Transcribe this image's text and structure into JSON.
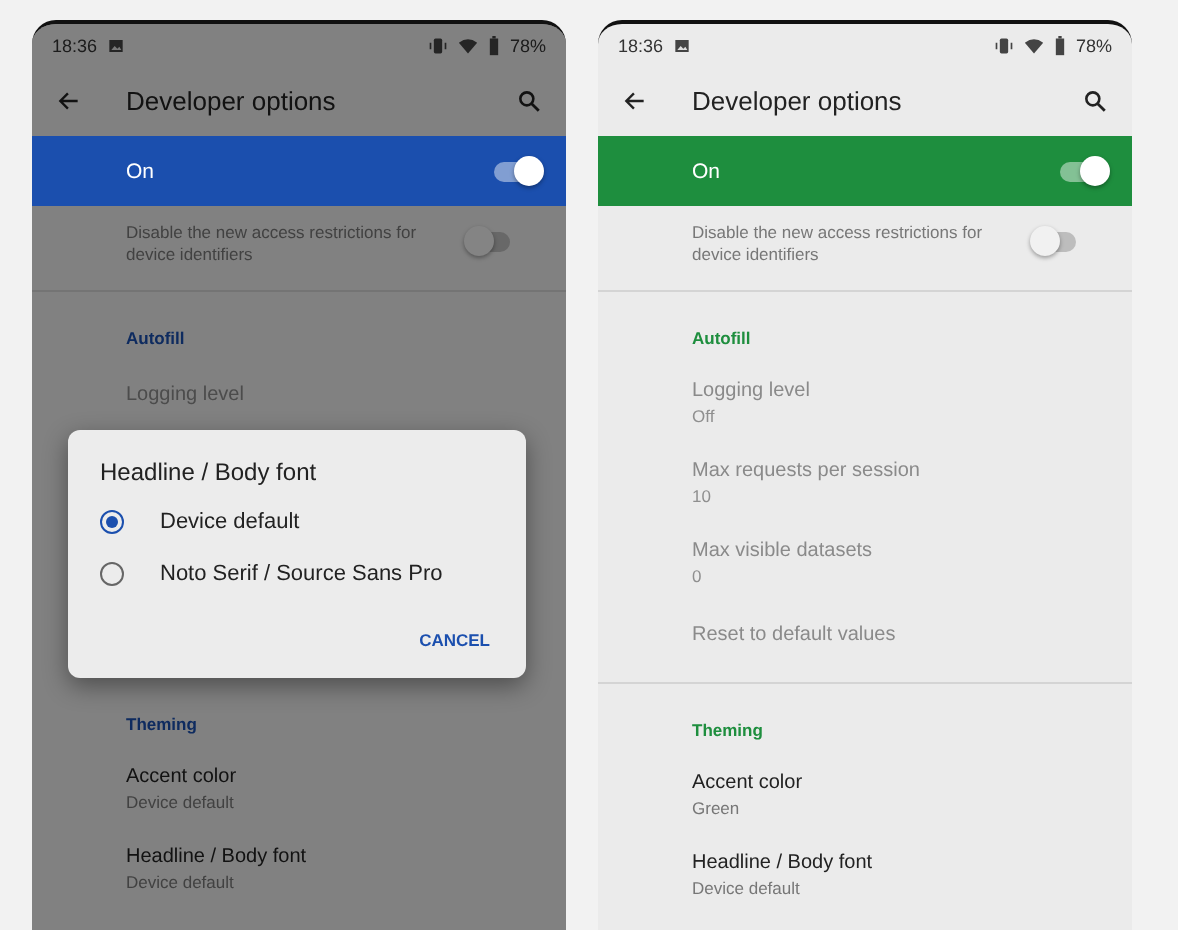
{
  "screens": [
    {
      "status_bar": {
        "time": "18:36",
        "battery": "78%"
      },
      "title": "Developer options",
      "color": "#1b4fae",
      "dimmed": true,
      "master_switch": {
        "label": "On",
        "on": true
      },
      "items": [
        {
          "kind": "switch",
          "summary": "Disable the new access restrictions for device identifiers",
          "on": false
        },
        {
          "kind": "divider"
        },
        {
          "kind": "header",
          "title": "Autofill"
        },
        {
          "kind": "pref",
          "title": "Logging level",
          "disabled": true
        }
      ],
      "dialog": {
        "title": "Headline / Body font",
        "options": [
          {
            "label": "Device default",
            "selected": true
          },
          {
            "label": "Noto Serif / Source Sans Pro",
            "selected": false
          }
        ],
        "button": "CANCEL"
      },
      "items_after": [
        {
          "kind": "header",
          "title": "Theming"
        },
        {
          "kind": "pref",
          "title": "Accent color",
          "summary": "Device default",
          "disabled": false
        },
        {
          "kind": "pref",
          "title": "Headline / Body font",
          "summary": "Device default",
          "disabled": false
        }
      ]
    },
    {
      "status_bar": {
        "time": "18:36",
        "battery": "78%"
      },
      "title": "Developer options",
      "color": "#1e8e3e",
      "dimmed": false,
      "master_switch": {
        "label": "On",
        "on": true
      },
      "items": [
        {
          "kind": "switch",
          "summary": "Disable the new access restrictions for device identifiers",
          "on": false
        },
        {
          "kind": "divider"
        },
        {
          "kind": "header",
          "title": "Autofill"
        },
        {
          "kind": "pref",
          "title": "Logging level",
          "summary": "Off",
          "disabled": true
        },
        {
          "kind": "pref",
          "title": "Max requests per session",
          "summary": "10",
          "disabled": true
        },
        {
          "kind": "pref",
          "title": "Max visible datasets",
          "summary": "0",
          "disabled": true
        },
        {
          "kind": "pref",
          "title": "Reset to default values",
          "disabled": true
        },
        {
          "kind": "divider"
        },
        {
          "kind": "header",
          "title": "Theming"
        },
        {
          "kind": "pref",
          "title": "Accent color",
          "summary": "Green",
          "disabled": false
        },
        {
          "kind": "pref",
          "title": "Headline / Body font",
          "summary": "Device default",
          "disabled": false
        }
      ]
    }
  ]
}
